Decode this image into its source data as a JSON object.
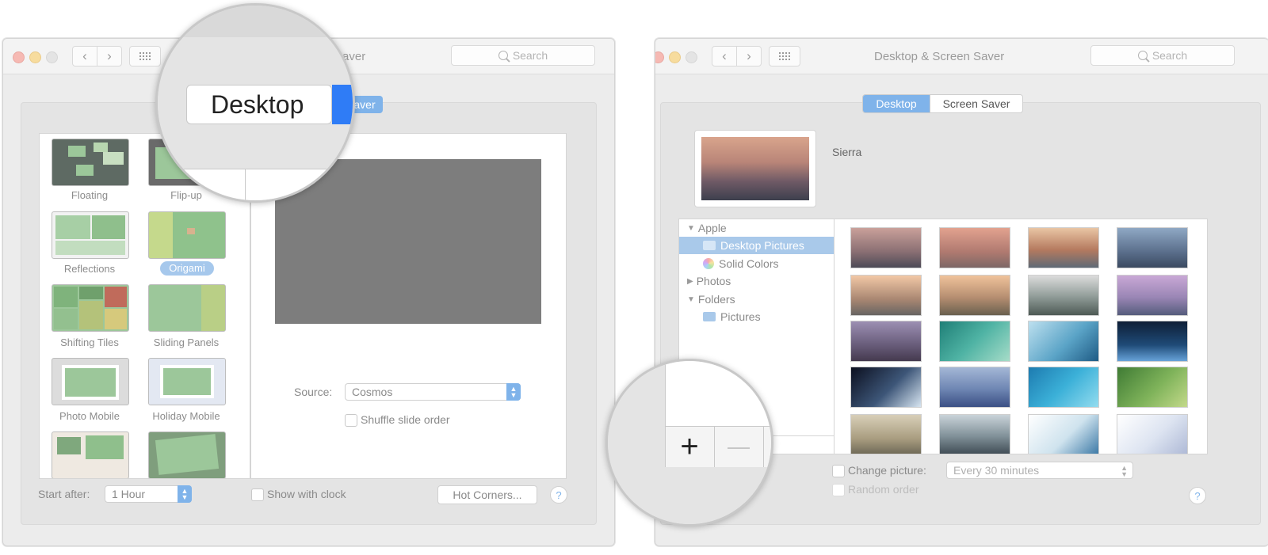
{
  "left_window": {
    "title": "Saver",
    "search_placeholder": "Search",
    "tab_label": "aver",
    "modules": [
      {
        "label": "Floating"
      },
      {
        "label": "Flip-up"
      },
      {
        "label": "Reflections"
      },
      {
        "label": "Origami"
      },
      {
        "label": "Shifting Tiles"
      },
      {
        "label": "Sliding Panels"
      },
      {
        "label": "Photo Mobile"
      },
      {
        "label": "Holiday Mobile"
      }
    ],
    "selected_module": "Origami",
    "source_label": "Source:",
    "source_value": "Cosmos",
    "shuffle_label": "Shuffle slide order",
    "start_after_label": "Start after:",
    "start_after_value": "1 Hour",
    "show_clock_label": "Show with clock",
    "hot_corners_label": "Hot Corners...",
    "help_glyph": "?",
    "zoom_label": "Desktop"
  },
  "right_window": {
    "title": "Desktop & Screen Saver",
    "search_placeholder": "Search",
    "tabs": [
      "Desktop",
      "Screen Saver"
    ],
    "active_tab": "Desktop",
    "current_picture_name": "Sierra",
    "sidebar": [
      {
        "label": "Apple",
        "disclosure": "▼",
        "indent": 0
      },
      {
        "label": "Desktop Pictures",
        "indent": 1,
        "selected": true
      },
      {
        "label": "Solid Colors",
        "indent": 1
      },
      {
        "label": "Photos",
        "disclosure": "▶",
        "indent": 0
      },
      {
        "label": "Folders",
        "disclosure": "▼",
        "indent": 0
      },
      {
        "label": "Pictures",
        "indent": 1
      }
    ],
    "change_picture_label": "Change picture:",
    "change_picture_value": "Every 30 minutes",
    "random_order_label": "Random order",
    "help_glyph": "?",
    "add_button": "+",
    "remove_button": "—"
  },
  "colors": {
    "accent": "#7fb3ea",
    "selected_row": "#a9c9ea"
  }
}
